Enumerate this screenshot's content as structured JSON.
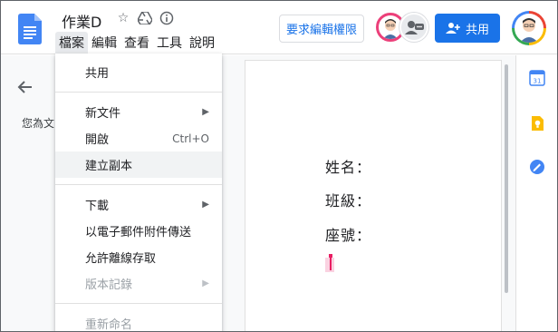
{
  "window": {
    "doc_title": "作業D"
  },
  "menubar": {
    "items": [
      "檔案",
      "編輯",
      "查看",
      "工具",
      "說明"
    ]
  },
  "header": {
    "request_edit_label": "要求編輯權限",
    "share_label": "共用"
  },
  "outline": {
    "text": "您為文"
  },
  "file_menu": {
    "share": "共用",
    "new_doc": "新文件",
    "open": "開啟",
    "open_shortcut": "Ctrl+O",
    "make_copy": "建立副本",
    "download": "下載",
    "email_attachment": "以電子郵件附件傳送",
    "offline": "允許離線存取",
    "version_history": "版本記錄",
    "rename": "重新命名"
  },
  "document": {
    "name_label": "姓名：",
    "class_label": "班級：",
    "seat_label": "座號："
  },
  "side_panel": {
    "calendar_day": "31"
  },
  "colors": {
    "accent": "#1a73e8",
    "cursor": "#e91e63"
  },
  "icons": [
    "docs-logo-icon",
    "star-icon",
    "drive-icon",
    "info-icon",
    "person-add-icon",
    "arrow-left-icon",
    "calendar-icon",
    "keep-icon",
    "tasks-icon",
    "chevron-right-icon"
  ]
}
